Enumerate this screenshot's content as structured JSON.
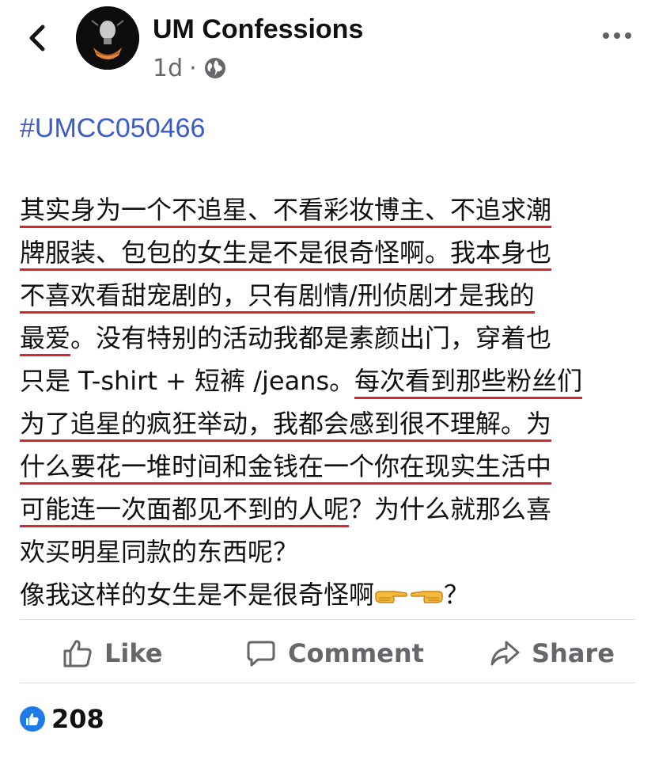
{
  "header": {
    "page_name": "UM Confessions",
    "time": "1d",
    "separator": "·",
    "privacy_icon": "globe-icon",
    "back_icon": "chevron-left-icon",
    "more_icon": "more-horizontal-icon"
  },
  "post": {
    "hashtag": "#UMCC050466",
    "lines": [
      [
        {
          "t": "其实身为一个不追星、不看彩妆博主、不追求潮",
          "u": true
        }
      ],
      [
        {
          "t": "牌服装、包包的女生是不是很奇怪啊。我本身也",
          "u": true
        }
      ],
      [
        {
          "t": "不喜欢看甜宠剧的，只有剧情/刑侦剧才是我的",
          "u": true
        }
      ],
      [
        {
          "t": "最爱",
          "u": true
        },
        {
          "t": "。没有特别的活动我都是素颜出门，穿着也",
          "u": false
        }
      ],
      [
        {
          "t": "只是 T-shirt + 短裤 /jeans。",
          "u": false
        },
        {
          "t": "每次看到那些粉丝们",
          "u": true
        }
      ],
      [
        {
          "t": "为了追星的疯狂举动，我都会感到很不理解。为",
          "u": true
        }
      ],
      [
        {
          "t": "什么要花一堆时间和金钱在一个你在现实生活中",
          "u": true
        }
      ],
      [
        {
          "t": "可能连一次面都见不到的人呢",
          "u": true
        },
        {
          "t": "？为什么就那么喜",
          "u": false
        }
      ],
      [
        {
          "t": "欢买明星同款的东西呢？",
          "u": false
        }
      ],
      [
        {
          "t": "像我这样的女生是不是很奇怪啊",
          "u": false
        },
        {
          "emoji": "pointing-right-hand-emoji"
        },
        {
          "emoji": "pointing-left-hand-emoji"
        },
        {
          "t": "？",
          "u": false
        }
      ]
    ]
  },
  "actions": {
    "like_label": "Like",
    "comment_label": "Comment",
    "share_label": "Share"
  },
  "reactions": {
    "count": "208",
    "icon": "like-reaction-icon"
  },
  "colors": {
    "hashtag": "#3b5bc6",
    "underline": "#d8262d",
    "muted": "#65676b",
    "like_blue": "#1f7be8"
  }
}
